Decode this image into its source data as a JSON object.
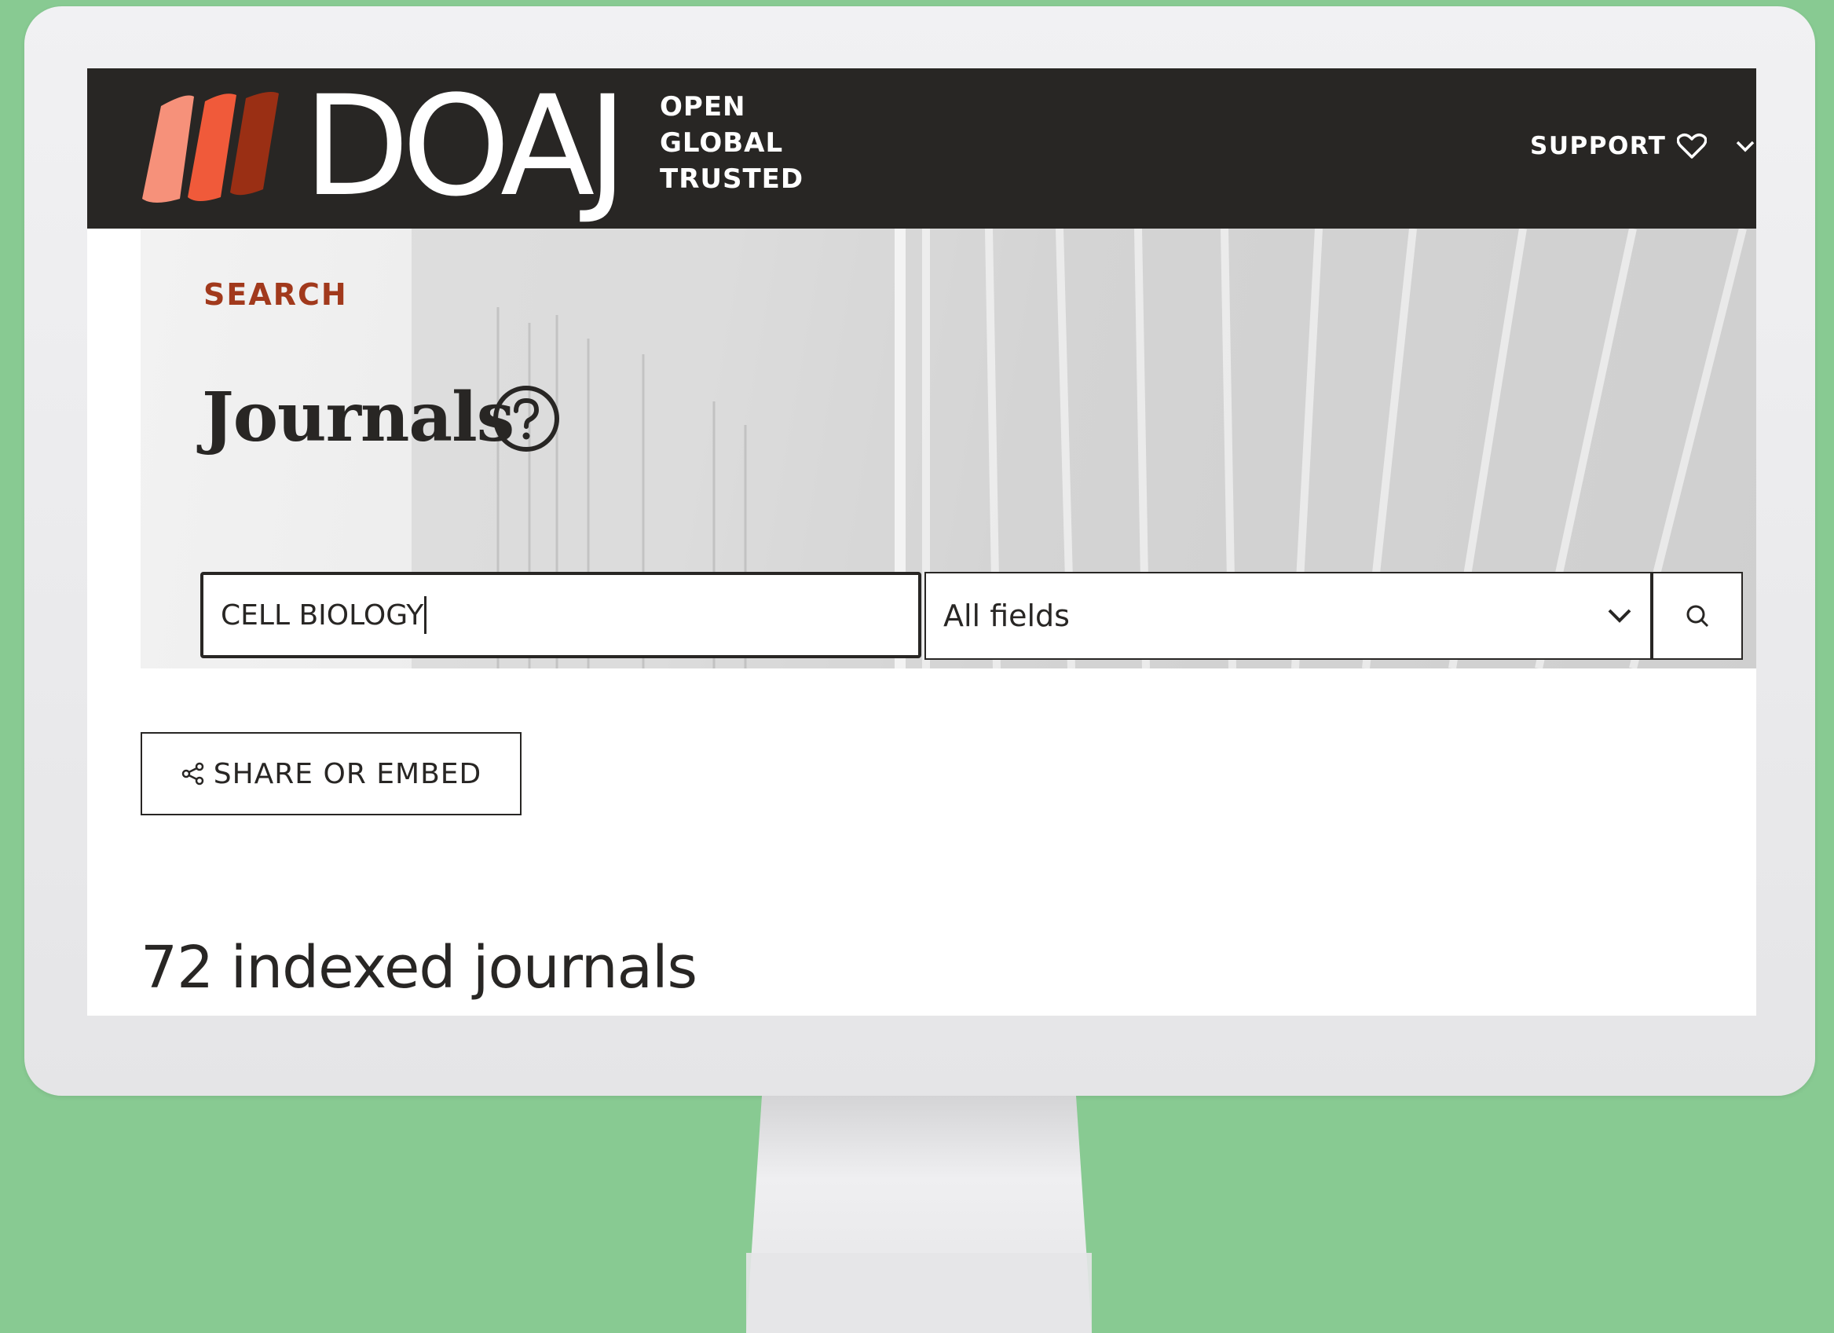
{
  "header": {
    "brand_name": "DOAJ",
    "tagline": [
      "OPEN",
      "GLOBAL",
      "TRUSTED"
    ],
    "support_label": "SUPPORT",
    "icons": [
      "logo-leaves-icon",
      "heart-icon",
      "chevron-down-icon"
    ]
  },
  "hero": {
    "section_label": "SEARCH",
    "title": "Journals",
    "help_icon": "question-circle-icon"
  },
  "search": {
    "query_value": "CELL BIOLOGY",
    "field_selected": "All fields",
    "submit_icon": "search-icon"
  },
  "share": {
    "label": "SHARE OR EMBED",
    "icon": "share-icon"
  },
  "results": {
    "count_text": "72 indexed journals"
  },
  "colors": {
    "page_background": "#88ca92",
    "header_background": "#282624",
    "accent": "#a1391c",
    "logo_leaf_light": "#f6917a",
    "logo_leaf_mid": "#f05a3a",
    "logo_leaf_dark": "#9a2f14"
  }
}
